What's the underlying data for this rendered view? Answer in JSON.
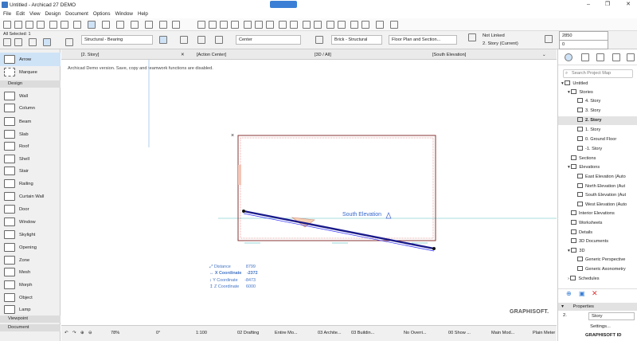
{
  "window": {
    "title": "Untitled - Archicad 27 DEMO"
  },
  "menu": [
    "File",
    "Edit",
    "View",
    "Design",
    "Document",
    "Options",
    "Window",
    "Help"
  ],
  "infobox": {
    "all_selected": "All Selected: 1",
    "structure": "Structural - Bearing",
    "center": "Center",
    "material": "Brick - Structural",
    "floor_plan": "Floor Plan and Section...",
    "linked": "Not Linked",
    "story": "2. Story (Current)",
    "height": "2850",
    "offset": "0"
  },
  "toolbox": {
    "arrow": "Arrow",
    "marquee": "Marquee",
    "design_header": "Design",
    "tools": [
      "Wall",
      "Column",
      "Beam",
      "Slab",
      "Roof",
      "Shell",
      "Stair",
      "Railing",
      "Curtain Wall",
      "Door",
      "Window",
      "Skylight",
      "Opening",
      "Zone",
      "Mesh",
      "Morph",
      "Object",
      "Lamp"
    ],
    "viewpoint": "Viewpoint",
    "document": "Document"
  },
  "tabs": [
    "[2. Story]",
    "[Action Center]",
    "[3D / All]",
    "[South Elevation]"
  ],
  "canvas": {
    "demo_notice": "Archicad Demo version. Save, copy and teamwork functions are disabled.",
    "elevation_label": "South Elevation",
    "tracker": [
      {
        "label": "Distance",
        "value": "8799"
      },
      {
        "label": "X Coordinate",
        "value": "-2372"
      },
      {
        "label": "Y Coordinate",
        "value": "-8473"
      },
      {
        "label": "Z Coordinate",
        "value": "6000"
      }
    ],
    "logo": "GRAPHISOFT."
  },
  "statusbar": {
    "zoom": "78%",
    "angle": "0°",
    "scale": "1:100",
    "items": [
      "02 Drafting",
      "Entire Mo...",
      "03 Archite...",
      "03 Buildin...",
      "No Overri...",
      "00 Show ...",
      "Main Mod...",
      "Plain Meter"
    ]
  },
  "navigator": {
    "search_placeholder": "Search Project Map",
    "root": "Untitled",
    "stories_header": "Stories",
    "stories": [
      "4. Story",
      "3. Story",
      "2. Story",
      "1. Story",
      "0. Ground Floor",
      "-1. Story"
    ],
    "sections": "Sections",
    "elevations_header": "Elevations",
    "elevations": [
      "East Elevation (Auto",
      "North Elevation (Aut",
      "South Elevation (Aut",
      "West Elevation (Auto"
    ],
    "other": [
      "Interior Elevations",
      "Worksheets",
      "Details",
      "3D Documents"
    ],
    "three_d": "3D",
    "three_d_items": [
      "Generic Perspective",
      "Generic Axonometry"
    ],
    "schedules": "Schedules",
    "properties_header": "Properties",
    "prop_id": "2.",
    "prop_value": "Story",
    "settings": "Settings...",
    "graphisoft_id": "GRAPHISOFT ID"
  }
}
